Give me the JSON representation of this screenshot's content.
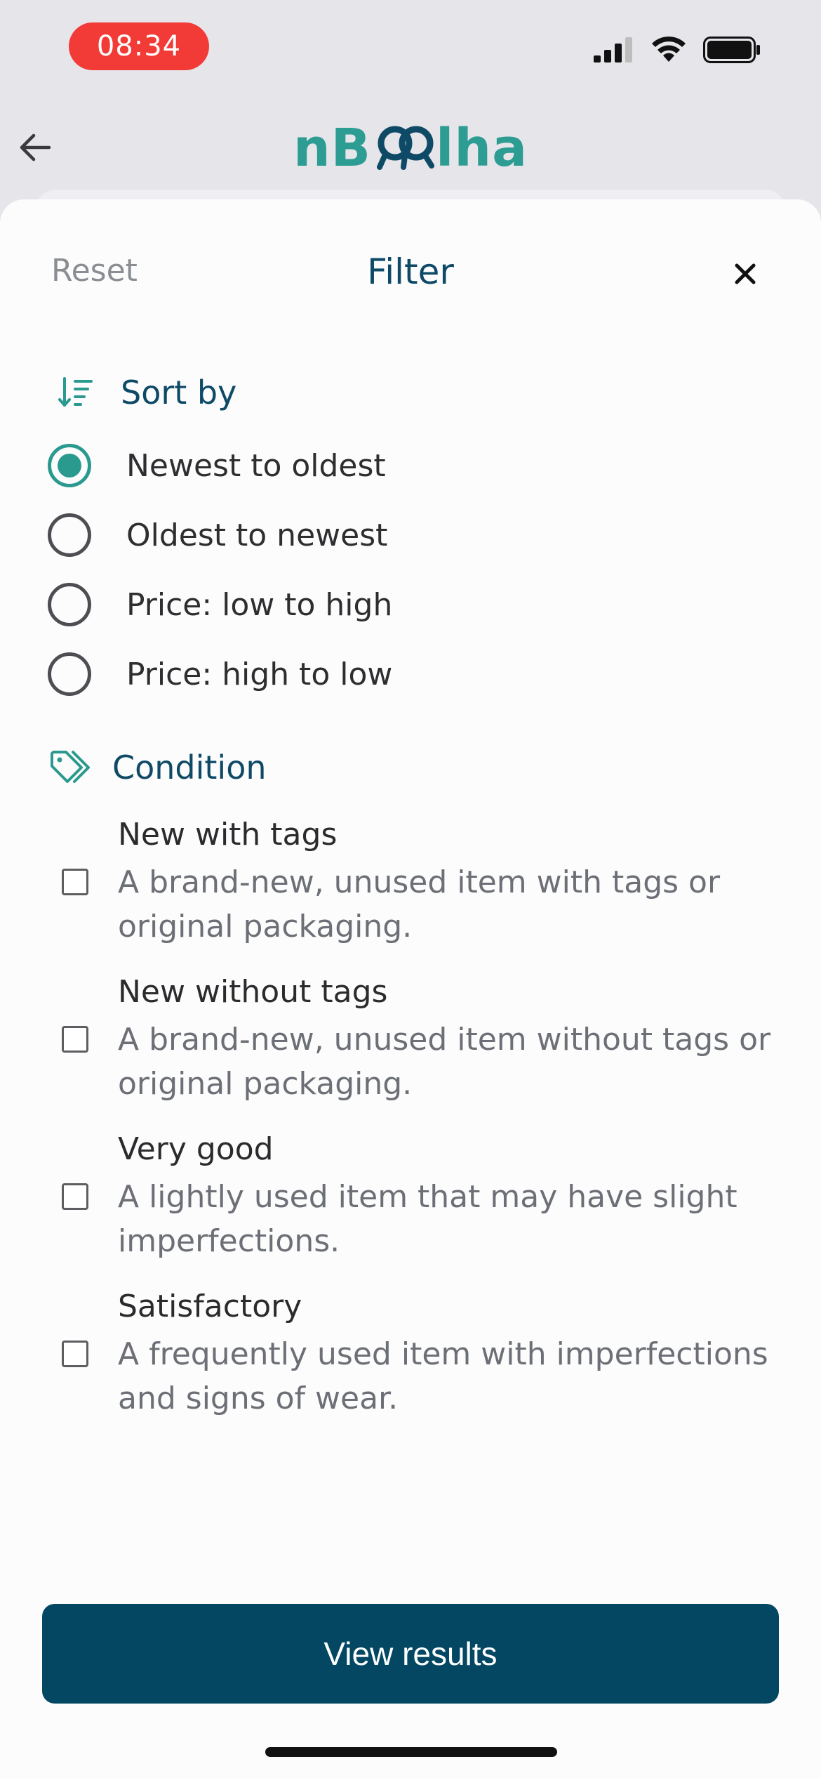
{
  "status_bar": {
    "time": "08:34"
  },
  "header": {
    "logo_text_left": "nB",
    "logo_text_right": "lha",
    "back_icon": "arrow-left-icon"
  },
  "sheet": {
    "reset_label": "Reset",
    "title": "Filter",
    "close_icon": "close-icon"
  },
  "sort": {
    "heading": "Sort by",
    "icon": "sort-icon",
    "options": [
      {
        "label": "Newest to oldest",
        "selected": true
      },
      {
        "label": "Oldest to newest",
        "selected": false
      },
      {
        "label": "Price: low to high",
        "selected": false
      },
      {
        "label": "Price: high to low",
        "selected": false
      }
    ]
  },
  "condition": {
    "heading": "Condition",
    "icon": "tag-icon",
    "items": [
      {
        "title": "New with tags",
        "description": "A brand-new, unused item with tags or original packaging.",
        "checked": false
      },
      {
        "title": "New without tags",
        "description": "A brand-new, unused item without tags or original packaging.",
        "checked": false
      },
      {
        "title": "Very good",
        "description": "A lightly used item that may have slight imperfections.",
        "checked": false
      },
      {
        "title": "Satisfactory",
        "description": "A frequently used item with imperfections and signs of wear.",
        "checked": false
      }
    ]
  },
  "footer": {
    "view_results_label": "View results"
  },
  "colors": {
    "accent_teal": "#2a9a8f",
    "navy": "#034763",
    "title_navy": "#0e4a66"
  }
}
